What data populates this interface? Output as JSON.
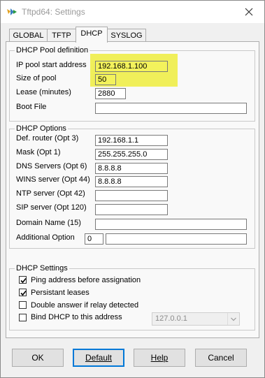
{
  "window": {
    "title": "Tftpd64: Settings"
  },
  "tabs": [
    {
      "label": "GLOBAL"
    },
    {
      "label": "TFTP"
    },
    {
      "label": "DHCP"
    },
    {
      "label": "SYSLOG"
    }
  ],
  "pool": {
    "title": "DHCP Pool definition",
    "start_label": "IP pool start address",
    "start_value": "192.168.1.100",
    "size_label": "Size of pool",
    "size_value": "50",
    "lease_label": "Lease (minutes)",
    "lease_value": "2880",
    "boot_label": "Boot File",
    "boot_value": ""
  },
  "options": {
    "title": "DHCP Options",
    "router_label": "Def. router (Opt 3)",
    "router_value": "192.168.1.1",
    "mask_label": "Mask (Opt 1)",
    "mask_value": "255.255.255.0",
    "dns_label": "DNS Servers (Opt 6)",
    "dns_value": "8.8.8.8",
    "wins_label": "WINS server (Opt 44)",
    "wins_value": "8.8.8.8",
    "ntp_label": "NTP server (Opt 42)",
    "ntp_value": "",
    "sip_label": "SIP server (Opt 120)",
    "sip_value": "",
    "domain_label": "Domain Name (15)",
    "domain_value": "",
    "additional_label": "Additional Option",
    "additional_num": "0",
    "additional_value": ""
  },
  "settings": {
    "title": "DHCP Settings",
    "ping_label": "Ping address before assignation",
    "ping_checked": true,
    "persist_label": "Persistant leases",
    "persist_checked": true,
    "double_label": "Double answer if relay detected",
    "double_checked": false,
    "bind_label": "Bind DHCP to this address",
    "bind_checked": false,
    "bind_address": "127.0.0.1"
  },
  "buttons": {
    "ok": "OK",
    "default": "Default",
    "help": "Help",
    "cancel": "Cancel"
  },
  "colors": {
    "highlight": "#f0ef5a",
    "default_button_border": "#0078d7"
  }
}
